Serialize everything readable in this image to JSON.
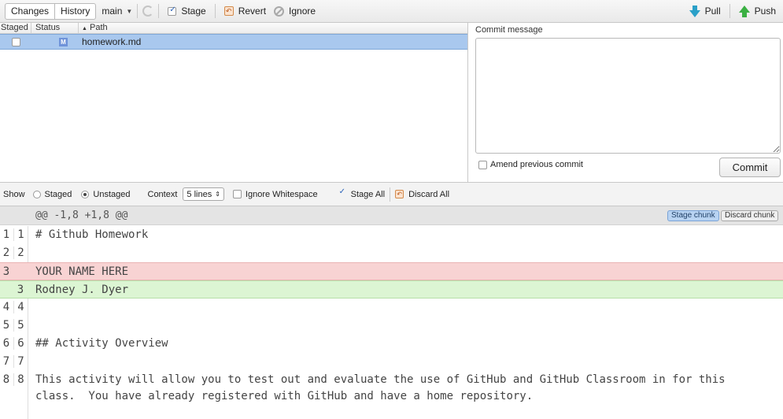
{
  "toolbar": {
    "tabs": [
      "Changes",
      "History"
    ],
    "branch": "main",
    "stage": "Stage",
    "revert": "Revert",
    "ignore": "Ignore",
    "pull": "Pull",
    "push": "Push"
  },
  "file_list": {
    "columns": [
      "Staged",
      "Status",
      "Path"
    ],
    "rows": [
      {
        "staged": false,
        "status": "M",
        "path": "homework.md"
      }
    ]
  },
  "commit": {
    "label": "Commit message",
    "message": "",
    "amend_label": "Amend previous commit",
    "amend_checked": false,
    "button": "Commit"
  },
  "diff_controls": {
    "show_label": "Show",
    "staged_label": "Staged",
    "unstaged_label": "Unstaged",
    "selected_view": "Unstaged",
    "context_label": "Context",
    "context_value": "5 lines",
    "ignore_ws_label": "Ignore Whitespace",
    "ignore_ws_checked": false,
    "stage_all_label": "Stage All",
    "stage_all_checked": true,
    "discard_all_label": "Discard All"
  },
  "diff": {
    "hunk_header": "@@ -1,8 +1,8 @@",
    "stage_chunk": "Stage chunk",
    "discard_chunk": "Discard chunk",
    "lines": [
      {
        "old": "1",
        "new": "1",
        "type": "context",
        "text": "# Github Homework"
      },
      {
        "old": "2",
        "new": "2",
        "type": "context",
        "text": ""
      },
      {
        "old": "3",
        "new": "",
        "type": "deleted",
        "text": "YOUR NAME HERE"
      },
      {
        "old": "",
        "new": "3",
        "type": "added",
        "text": "Rodney J. Dyer"
      },
      {
        "old": "4",
        "new": "4",
        "type": "context",
        "text": ""
      },
      {
        "old": "5",
        "new": "5",
        "type": "context",
        "text": ""
      },
      {
        "old": "6",
        "new": "6",
        "type": "context",
        "text": "## Activity Overview"
      },
      {
        "old": "7",
        "new": "7",
        "type": "context",
        "text": ""
      },
      {
        "old": "8",
        "new": "8",
        "type": "context",
        "text": "This activity will allow you to test out and evaluate the use of GitHub and GitHub Classroom in for this\nclass.  You have already registered with GitHub and have a home repository."
      }
    ]
  },
  "colors": {
    "deleted_bg": "#f8d3d3",
    "added_bg": "#dcf5d3",
    "selected_row": "#a9c8ee"
  }
}
